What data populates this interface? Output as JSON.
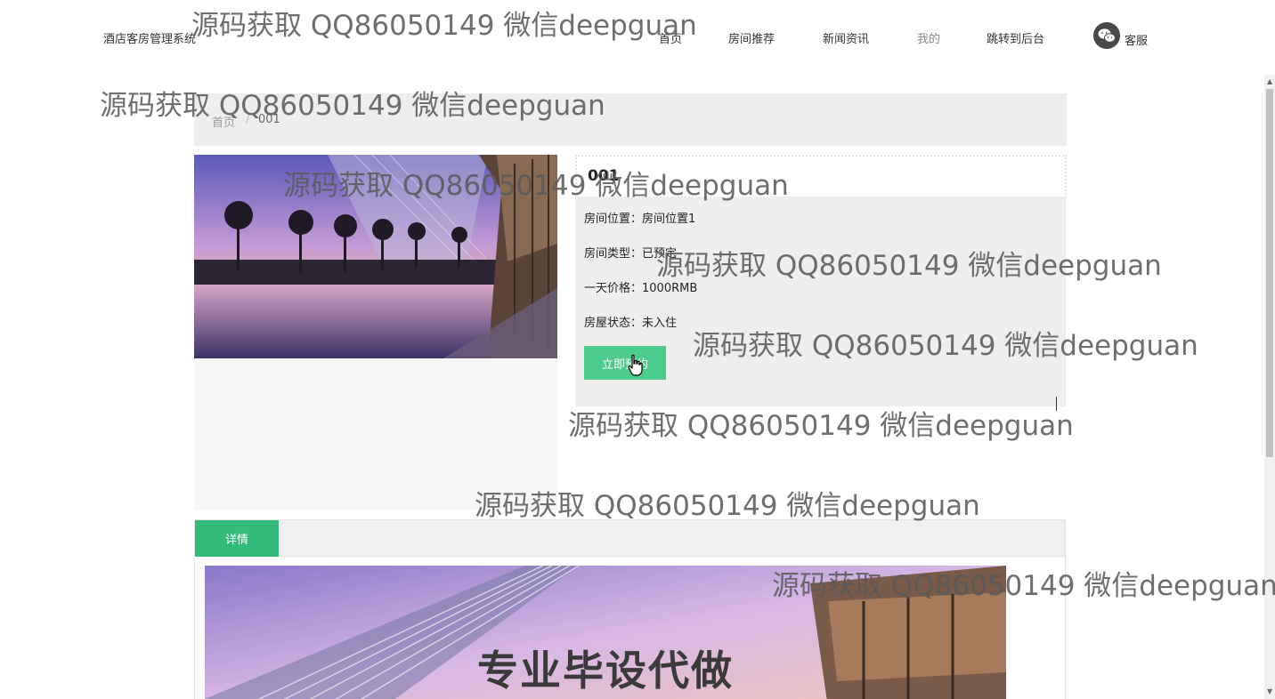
{
  "header": {
    "site_title": "酒店客房管理系统",
    "nav": [
      "首页",
      "房间推荐",
      "新闻资讯",
      "我的",
      "跳转到后台"
    ],
    "active_nav": "我的",
    "service_label": "客服"
  },
  "breadcrumb": {
    "home": "首页",
    "separator": "/",
    "current": "001"
  },
  "room": {
    "name": "001",
    "fields": [
      {
        "label": "房间位置：",
        "value": "房间位置1"
      },
      {
        "label": "房间类型：",
        "value": "已预定"
      },
      {
        "label": "一天价格：",
        "value": "1000RMB"
      },
      {
        "label": "房屋状态：",
        "value": "未入住"
      }
    ],
    "book_button": "立即预约"
  },
  "tabs": {
    "details": "详情"
  },
  "detail_banner": "专业毕设代做",
  "watermark": "源码获取 QQ86050149 微信deepguan",
  "colors": {
    "accent": "#33bb7a",
    "button": "#4ccc8c",
    "panel_bg": "#eeeeec"
  }
}
